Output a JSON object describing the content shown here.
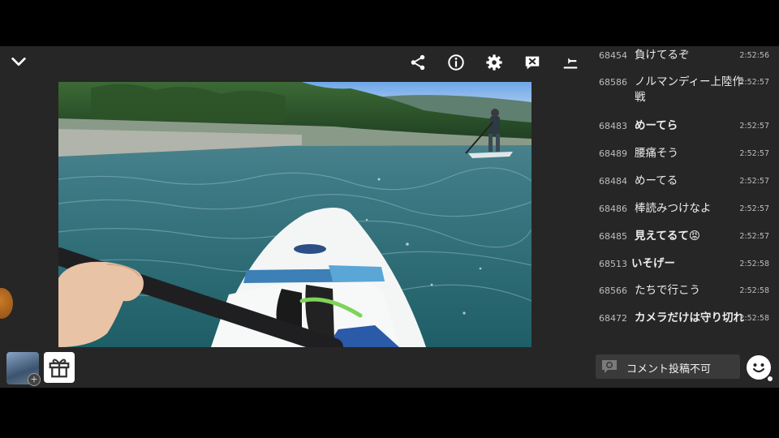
{
  "toolbar": {
    "icons": [
      "chevron-down-icon",
      "share-icon",
      "info-icon",
      "gear-icon",
      "comment-hide-icon",
      "download-icon"
    ]
  },
  "comments": [
    {
      "num": "68454",
      "text": "負けてるぞ",
      "time": "2:52:56"
    },
    {
      "num": "68586",
      "text": "ノルマンディー上陸作戦",
      "time": "2:52:57"
    },
    {
      "num": "68483",
      "text": "めーてら",
      "time": "2:52:57"
    },
    {
      "num": "68489",
      "text": "腰痛そう",
      "time": "2:52:57"
    },
    {
      "num": "68484",
      "text": "めーてる",
      "time": "2:52:57"
    },
    {
      "num": "68486",
      "text": "棒読みつけなよ",
      "time": "2:52:57"
    },
    {
      "num": "68485",
      "text": "見えてるて😡",
      "time": "2:52:57"
    },
    {
      "num": "68513",
      "text": "いそげー",
      "time": "2:52:58"
    },
    {
      "num": "68566",
      "text": "たちで行こう",
      "time": "2:52:58"
    },
    {
      "num": "68472",
      "text": "カメラだけは守り切れ",
      "time": "2:52:58"
    }
  ],
  "comment_input": {
    "label": "コメント投稿不可"
  },
  "colors": {
    "background": "#262626",
    "text": "#ececec",
    "muted": "#bdbdbd",
    "input_bg": "#3a3a3a"
  }
}
